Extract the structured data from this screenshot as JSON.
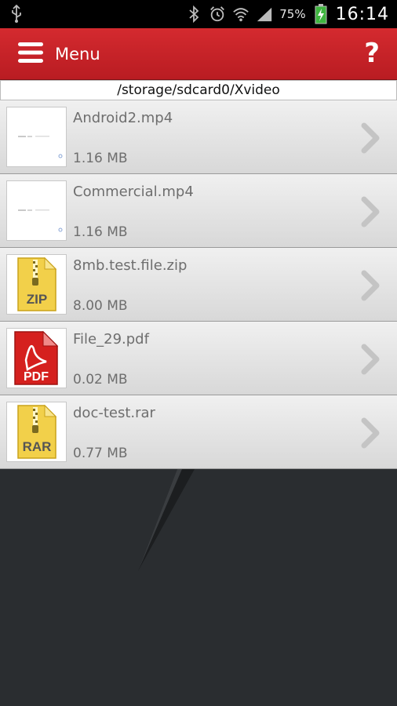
{
  "status_bar": {
    "battery_percent": "75%",
    "time": "16:14",
    "icons": [
      "usb-icon",
      "bluetooth-icon",
      "alarm-icon",
      "wifi-icon",
      "signal-icon",
      "battery-charging-icon"
    ]
  },
  "header": {
    "menu_label": "Menu",
    "help_label": "?",
    "color": "#c8232a"
  },
  "path": "/storage/sdcard0/Xvideo",
  "files": [
    {
      "name": "Android2.mp4",
      "size": "1.16 MB",
      "thumb": "video-thumbnail"
    },
    {
      "name": "Commercial.mp4",
      "size": "1.16 MB",
      "thumb": "video-thumbnail"
    },
    {
      "name": "8mb.test.file.zip",
      "size": "8.00 MB",
      "thumb": "zip-file-icon",
      "badge": "ZIP"
    },
    {
      "name": "File_29.pdf",
      "size": "0.02 MB",
      "thumb": "pdf-file-icon",
      "badge": "PDF"
    },
    {
      "name": "doc-test.rar",
      "size": "0.77 MB",
      "thumb": "rar-file-icon",
      "badge": "RAR"
    }
  ]
}
